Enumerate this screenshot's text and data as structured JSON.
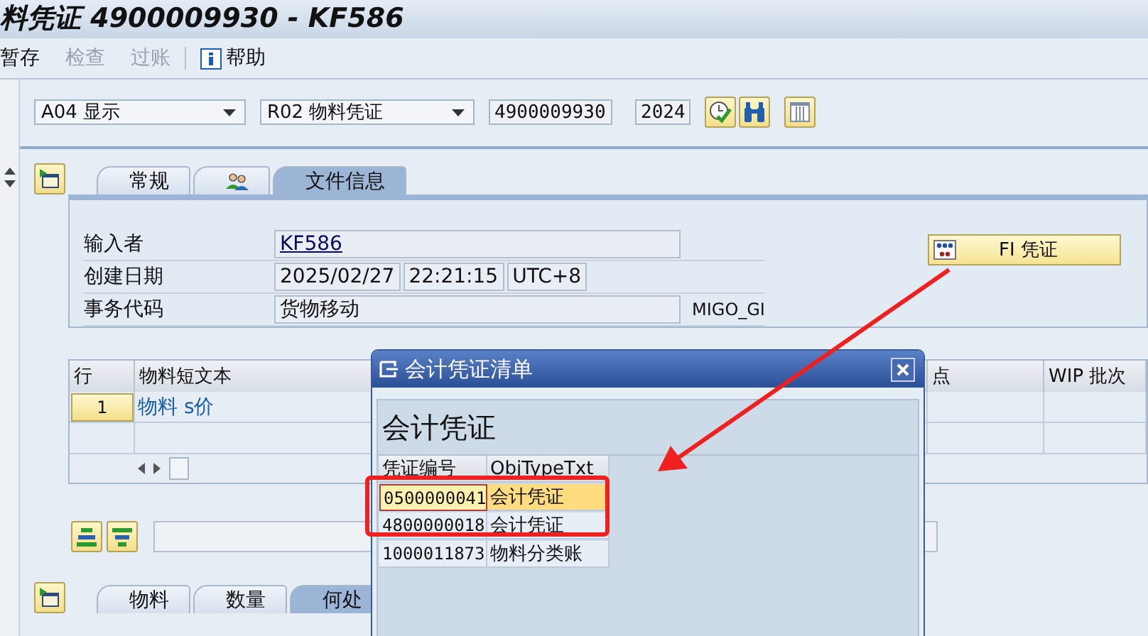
{
  "window": {
    "title": "料凭证 4900009930 - KF586"
  },
  "toolbar": [
    {
      "kind": "text",
      "label": "暂存",
      "disabled": false
    },
    {
      "kind": "text",
      "label": "检查",
      "disabled": true
    },
    {
      "kind": "text",
      "label": "过账",
      "disabled": true
    },
    {
      "kind": "separator"
    },
    {
      "kind": "info",
      "label": "帮助",
      "disabled": false
    }
  ],
  "selectors": {
    "action": "A04 显示",
    "reference": "R02 物料凭证",
    "document": "4900009930",
    "year": "2024"
  },
  "header_tabs": [
    {
      "kind": "text",
      "label": "常规",
      "selected": false
    },
    {
      "kind": "icon",
      "selected": false
    },
    {
      "kind": "text",
      "label": "文件信息",
      "selected": true
    }
  ],
  "doc_info": {
    "rows": [
      {
        "label": "输入者",
        "kind": "link",
        "values": [
          "KF586"
        ]
      },
      {
        "label": "创建日期",
        "kind": "plain",
        "values": [
          "2025/02/27",
          "22:21:15",
          "UTC+8"
        ]
      },
      {
        "label": "事务代码",
        "kind": "plain",
        "values": [
          "货物移动"
        ],
        "suffix": "MIGO_GI"
      }
    ],
    "fi_button": "FI 凭证"
  },
  "items_table": {
    "columns": [
      "行",
      "物料短文本",
      "点",
      "WIP 批次"
    ],
    "rows": [
      {
        "line": "1",
        "text": "物料 s价"
      }
    ]
  },
  "detail_tabs": [
    {
      "label": "物料",
      "selected": false
    },
    {
      "label": "数量",
      "selected": false
    },
    {
      "label": "何处",
      "selected": true
    }
  ],
  "popup": {
    "title": "会计凭证清单",
    "heading": "会计凭证",
    "columns": [
      "凭证编号",
      "ObjTypeTxt"
    ],
    "rows": [
      {
        "number": "0500000041",
        "type": "会计凭证",
        "selected": true
      },
      {
        "number": "4800000018",
        "type": "会计凭证",
        "selected": false
      },
      {
        "number": "1000011873",
        "type": "物料分类账",
        "selected": false
      }
    ]
  }
}
